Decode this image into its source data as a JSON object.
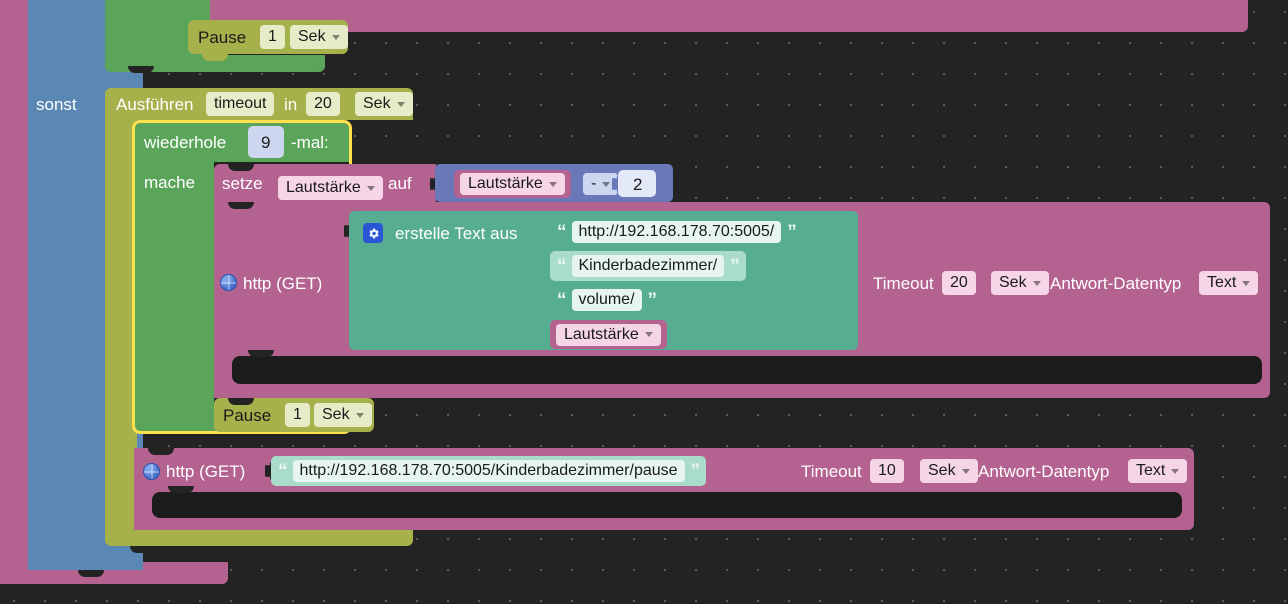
{
  "workspace": {
    "background_color": "#232323",
    "grid_dot_color": "#5a5a5a"
  },
  "palette": {
    "control_olive": "#a6b14b",
    "loop_green": "#5ba55b",
    "logic_blue": "#5b87b4",
    "net_pink": "#b4628f",
    "text_teal": "#56ad92",
    "math_blue": "#6878b8",
    "selection_yellow": "#ffe14d"
  },
  "blocks": {
    "if_else": {
      "else_label": "sonst"
    },
    "pause_top": {
      "label": "Pause",
      "value": "1",
      "unit": "Sek",
      "unit_caret": "chevron-down-icon"
    },
    "execute_timeout": {
      "label": "Ausführen",
      "name_field": "timeout",
      "in_label": "in",
      "value": "20",
      "unit": "Sek"
    },
    "repeat": {
      "label": "wiederhole",
      "times": "9",
      "suffix": "-mal:",
      "do_label": "mache",
      "selected": true
    },
    "set_variable": {
      "label": "setze",
      "variable": "Lautstärke",
      "to_label": "auf"
    },
    "math_arithmetic": {
      "operand_a": "Lautstärke",
      "operator": "-",
      "operand_b": "2"
    },
    "http_get_volume": {
      "icon": "globe-icon",
      "label": "http (GET)",
      "timeout_label": "Timeout",
      "timeout_value": "20",
      "timeout_unit": "Sek",
      "response_label": "Antwort-Datentyp",
      "response_type": "Text"
    },
    "text_join": {
      "mutator_icon": "gear-icon",
      "label": "erstelle Text aus",
      "items": [
        {
          "kind": "text",
          "value": "http://192.168.178.70:5005/"
        },
        {
          "kind": "text",
          "value": "Kinderbadezimmer/"
        },
        {
          "kind": "text",
          "value": "volume/"
        },
        {
          "kind": "variable",
          "value": "Lautstärke"
        }
      ]
    },
    "pause_inner": {
      "label": "Pause",
      "value": "1",
      "unit": "Sek"
    },
    "http_get_pause": {
      "icon": "globe-icon",
      "label": "http (GET)",
      "url": "http://192.168.178.70:5005/Kinderbadezimmer/pause",
      "timeout_label": "Timeout",
      "timeout_value": "10",
      "timeout_unit": "Sek",
      "response_label": "Antwort-Datentyp",
      "response_type": "Text"
    }
  }
}
